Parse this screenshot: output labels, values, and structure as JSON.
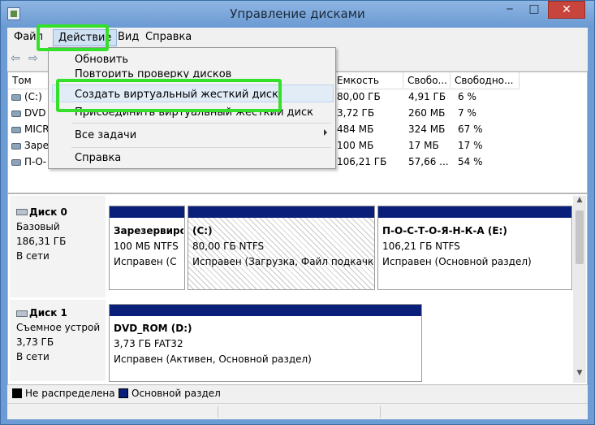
{
  "window": {
    "title": "Управление дисками",
    "buttons": {
      "minimize": "‒",
      "maximize": "□",
      "close": "✕"
    }
  },
  "menubar": {
    "file": "Файл",
    "action": "Действие",
    "view": "Вид",
    "help": "Справка"
  },
  "toolbar": {
    "back_icon": "arrow-left-icon",
    "forward_icon": "arrow-right-icon"
  },
  "volume_list": {
    "columns": [
      "Том",
      "Емкость",
      "Свобо...",
      "Свободно..."
    ],
    "rows": [
      {
        "name": "(C:)",
        "capacity": "80,00 ГБ",
        "free": "4,91 ГБ",
        "free_pct": "6 %"
      },
      {
        "name": "DVD",
        "capacity": "3,72 ГБ",
        "free": "260 МБ",
        "free_pct": "7 %"
      },
      {
        "name": "MICR",
        "capacity": "484 МБ",
        "free": "324 МБ",
        "free_pct": "67 %"
      },
      {
        "name": "Заре",
        "capacity": "100 МБ",
        "free": "17 МБ",
        "free_pct": "17 %"
      },
      {
        "name": "П-О-",
        "capacity": "106,21 ГБ",
        "free": "57,66 ...",
        "free_pct": "54 %"
      }
    ]
  },
  "action_menu": {
    "items": [
      "Обновить",
      "Повторить проверку дисков",
      "Создать виртуальный жесткий диск",
      "Присоединить виртуальный жесткий диск",
      "Все задачи",
      "Справка"
    ]
  },
  "disks": [
    {
      "title": "Диск 0",
      "type": "Базовый",
      "size": "186,31 ГБ",
      "status": "В сети",
      "partitions": [
        {
          "name": "Зарезервиро",
          "size": "100 МБ NTFS",
          "status": "Исправен (С"
        },
        {
          "name": "(C:)",
          "size": "80,00 ГБ NTFS",
          "status": "Исправен (Загрузка, Файл подкачк"
        },
        {
          "name": "П-О-С-Т-О-Я-Н-К-А  (E:)",
          "size": "106,21 ГБ NTFS",
          "status": "Исправен (Основной раздел)"
        }
      ]
    },
    {
      "title": "Диск 1",
      "type": "Съемное устрой",
      "size": "3,73 ГБ",
      "status": "В сети",
      "partitions": [
        {
          "name": "DVD_ROM  (D:)",
          "size": "3,73 ГБ FAT32",
          "status": "Исправен (Активен, Основной раздел)"
        }
      ]
    }
  ],
  "legend": {
    "unallocated": "Не распределена",
    "primary": "Основной раздел",
    "colors": {
      "unallocated": "#000000",
      "primary": "#0a1f7a"
    }
  },
  "highlight_color": "#34e02a"
}
